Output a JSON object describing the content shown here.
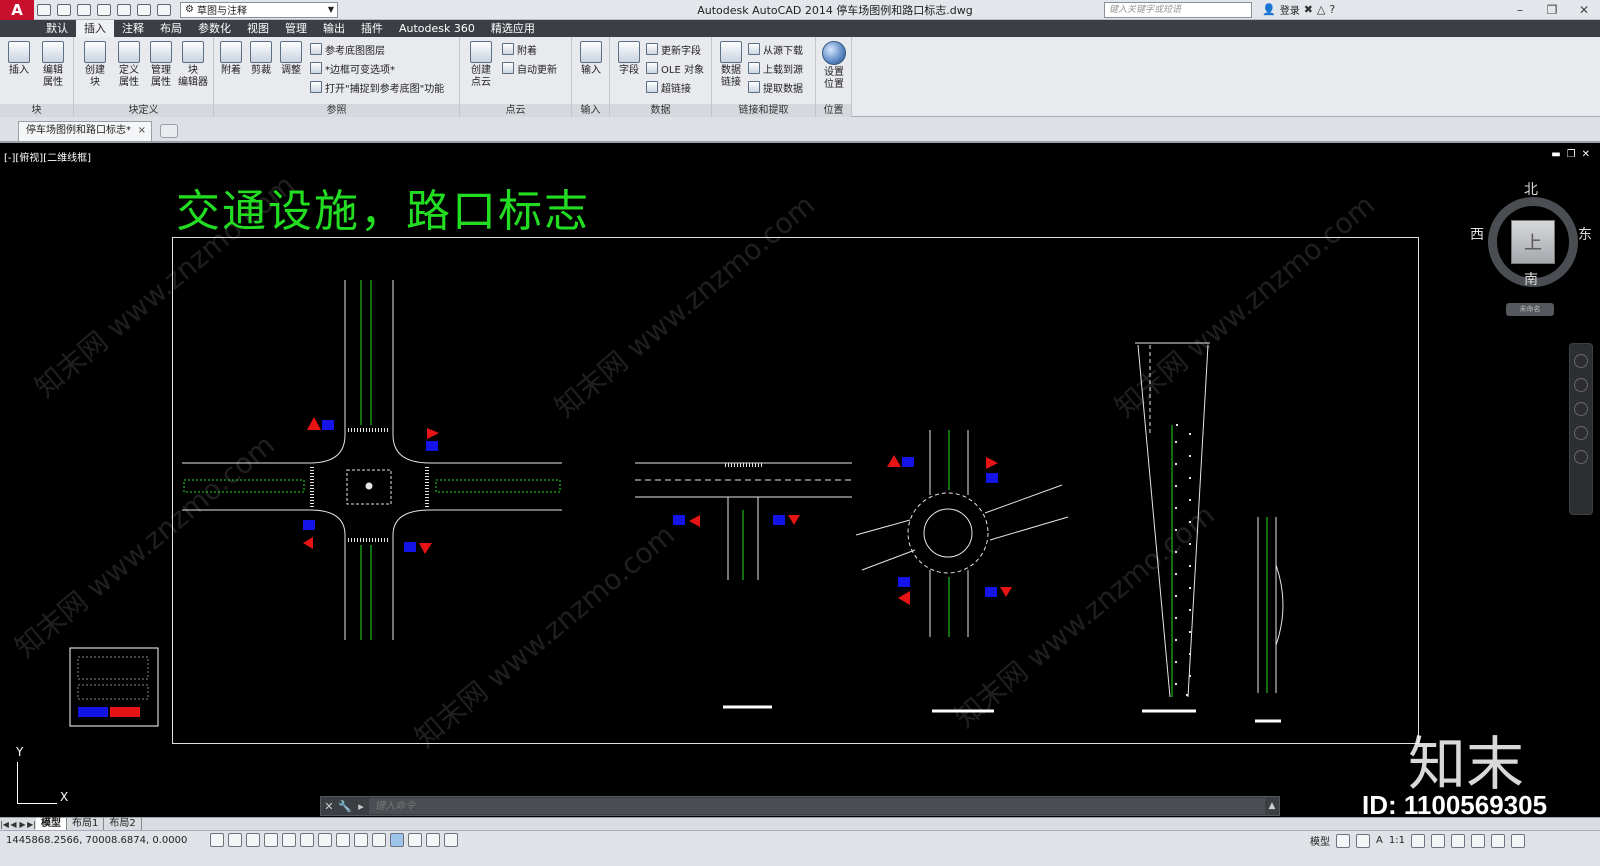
{
  "app": {
    "logo": "A",
    "workspace": "草图与注释",
    "window_title": "Autodesk AutoCAD 2014    停车场图例和路口标志.dwg",
    "search_placeholder": "键入关键字或短语",
    "login": "登录"
  },
  "ribbon_tabs": [
    "默认",
    "插入",
    "注释",
    "布局",
    "参数化",
    "视图",
    "管理",
    "输出",
    "插件",
    "Autodesk 360",
    "精选应用"
  ],
  "active_tab_index": 1,
  "panels": {
    "block": {
      "title": "块",
      "buttons": [
        "插入",
        "编辑\n属性"
      ]
    },
    "block_def": {
      "title": "块定义",
      "buttons": [
        "创建\n块",
        "定义\n属性",
        "管理\n属性",
        "块\n编辑器"
      ]
    },
    "reference": {
      "title": "参照",
      "buttons": [
        "附着",
        "剪裁",
        "调整"
      ],
      "small": [
        "参考底图图层",
        "*边框可变选项*",
        "打开\"捕捉到参考底图\"功能"
      ]
    },
    "cloud": {
      "title": "点云",
      "buttons": [
        "创建\n点云"
      ],
      "small": [
        "附着",
        "自动更新"
      ]
    },
    "import": {
      "title": "输入",
      "buttons": [
        "输入"
      ]
    },
    "data": {
      "title": "数据",
      "buttons": [
        "字段"
      ],
      "small": [
        "更新字段",
        "OLE 对象",
        "超链接"
      ]
    },
    "link": {
      "title": "链接和提取",
      "buttons": [
        "数据\n链接"
      ],
      "small": [
        "从源下载",
        "上载到源",
        "提取数据"
      ]
    },
    "location": {
      "title": "位置",
      "buttons": [
        "设置\n位置"
      ]
    }
  },
  "file_tab": "停车场图例和路口标志*",
  "viewport_label": "[-][俯视][二维线框]",
  "drawing_title": "交通设施，路口标志",
  "viewcube": {
    "north": "北",
    "south": "南",
    "east": "东",
    "west": "西",
    "top": "上",
    "wcs": "未命名"
  },
  "ucs": {
    "x": "X",
    "y": "Y"
  },
  "watermark": {
    "logo": "知末",
    "id": "ID: 1100569305",
    "text": "知末网 www.znzmo.com"
  },
  "command_placeholder": "键入命令",
  "layout_tabs": [
    "模型",
    "布局1",
    "布局2"
  ],
  "coords": "1445868.2566,  70008.6874,  0.0000",
  "status": {
    "model": "模型",
    "scale": "1:1"
  },
  "colors": {
    "road_line": "#e6e6e6",
    "green": "#22dd22",
    "sign_blue": "#1414e6",
    "sign_red": "#e61414"
  }
}
